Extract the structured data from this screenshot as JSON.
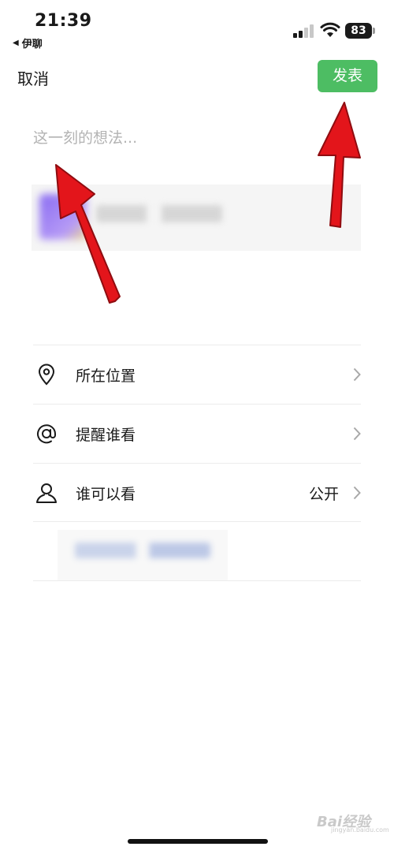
{
  "status_bar": {
    "time": "21:39",
    "back_app": "伊聊",
    "battery": "83"
  },
  "nav": {
    "cancel_label": "取消",
    "publish_label": "发表"
  },
  "composer": {
    "placeholder": "这一刻的想法..."
  },
  "options": [
    {
      "label": "所在位置",
      "value": "",
      "icon": "location-pin-icon"
    },
    {
      "label": "提醒谁看",
      "value": "",
      "icon": "at-sign-icon"
    },
    {
      "label": "谁可以看",
      "value": "公开",
      "icon": "person-icon"
    }
  ],
  "colors": {
    "publish_button": "#4dbd63",
    "annotation_arrow": "#e3151b"
  },
  "watermark": {
    "brand": "Bai经验",
    "url": "jingyan.baidu.com"
  }
}
